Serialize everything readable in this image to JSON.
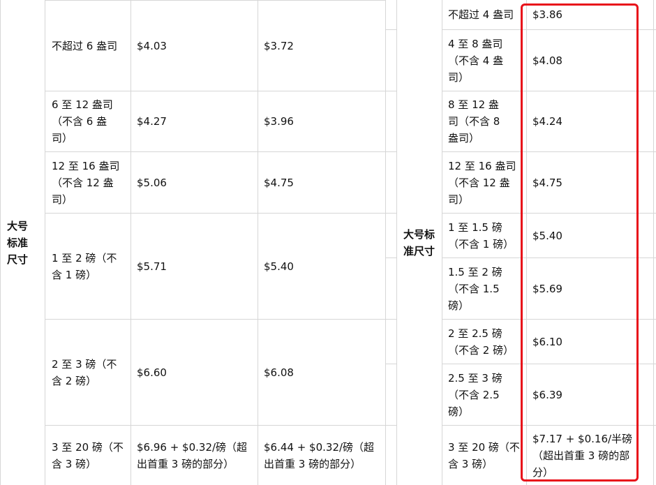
{
  "left_table": {
    "category": "大号标准尺寸",
    "rows": [
      {
        "weight": "不超过 6 盎司",
        "fee_a": "$4.03",
        "fee_b": "$3.72"
      },
      {
        "weight": "6 至 12 盎司（不含 6 盎司）",
        "fee_a": "$4.27",
        "fee_b": "$3.96"
      },
      {
        "weight": "12 至 16 盎司（不含 12 盎司）",
        "fee_a": "$5.06",
        "fee_b": "$4.75"
      },
      {
        "weight": "1 至 2 磅（不含 1 磅）",
        "fee_a": "$5.71",
        "fee_b": "$5.40"
      },
      {
        "weight": "2 至 3 磅（不含 2 磅）",
        "fee_a": "$6.60",
        "fee_b": "$6.08"
      },
      {
        "weight": "3 至 20 磅（不含 3 磅）",
        "fee_a": "$6.96 + $0.32/磅（超出首重 3 磅的部分）",
        "fee_b": "$6.44 + $0.32/磅（超出首重 3 磅的部分）"
      }
    ]
  },
  "right_table": {
    "category": "大号标准尺寸",
    "rows": [
      {
        "weight": "不超过 4 盎司",
        "fee": "$3.86"
      },
      {
        "weight": "4 至 8 盎司（不含 4 盎司）",
        "fee": "$4.08"
      },
      {
        "weight": "8 至 12 盎司（不含 8 盎司）",
        "fee": "$4.24"
      },
      {
        "weight": "12 至 16 盎司（不含 12 盎司）",
        "fee": "$4.75"
      },
      {
        "weight": "1 至 1.5 磅（不含 1 磅）",
        "fee": "$5.40"
      },
      {
        "weight": "1.5 至 2 磅（不含 1.5 磅）",
        "fee": "$5.69"
      },
      {
        "weight": "2 至 2.5 磅（不含 2 磅）",
        "fee": "$6.10"
      },
      {
        "weight": "2.5 至 3 磅（不含 2.5 磅）",
        "fee": "$6.39"
      },
      {
        "weight": "3 至 20 磅（不含 3 磅）",
        "fee": "$7.17 + $0.16/半磅（超出首重 3 磅的部分）"
      }
    ]
  },
  "colors": {
    "highlight": "#e8101a",
    "grid": "#d6d6d6"
  }
}
